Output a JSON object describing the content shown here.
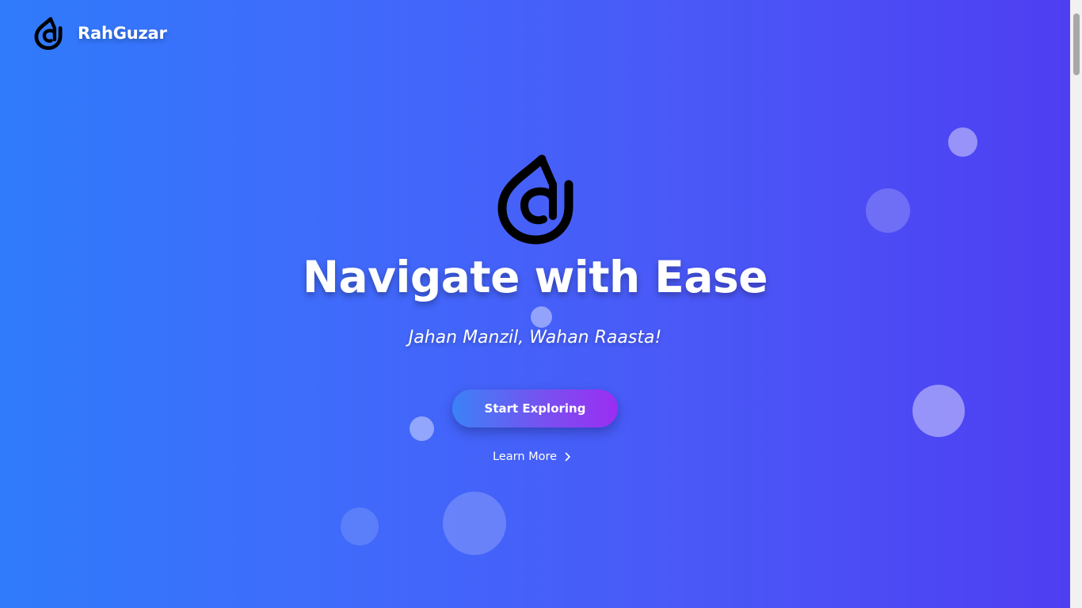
{
  "brand": {
    "name": "RahGuzar",
    "logo_icon": "rahguzar-logo-icon"
  },
  "hero": {
    "title": "Navigate with Ease",
    "subtitle": "Jahan Manzil, Wahan Raasta!",
    "primary_cta": "Start Exploring",
    "secondary_cta": "Learn More",
    "secondary_cta_icon": "chevron-right-icon"
  },
  "colors": {
    "background_gradient": [
      "#2f7bfb",
      "#4e3ef2"
    ],
    "button_gradient": [
      "#3b82f6",
      "#9b2df3"
    ],
    "text": "#ffffff",
    "logo": "#000000"
  }
}
